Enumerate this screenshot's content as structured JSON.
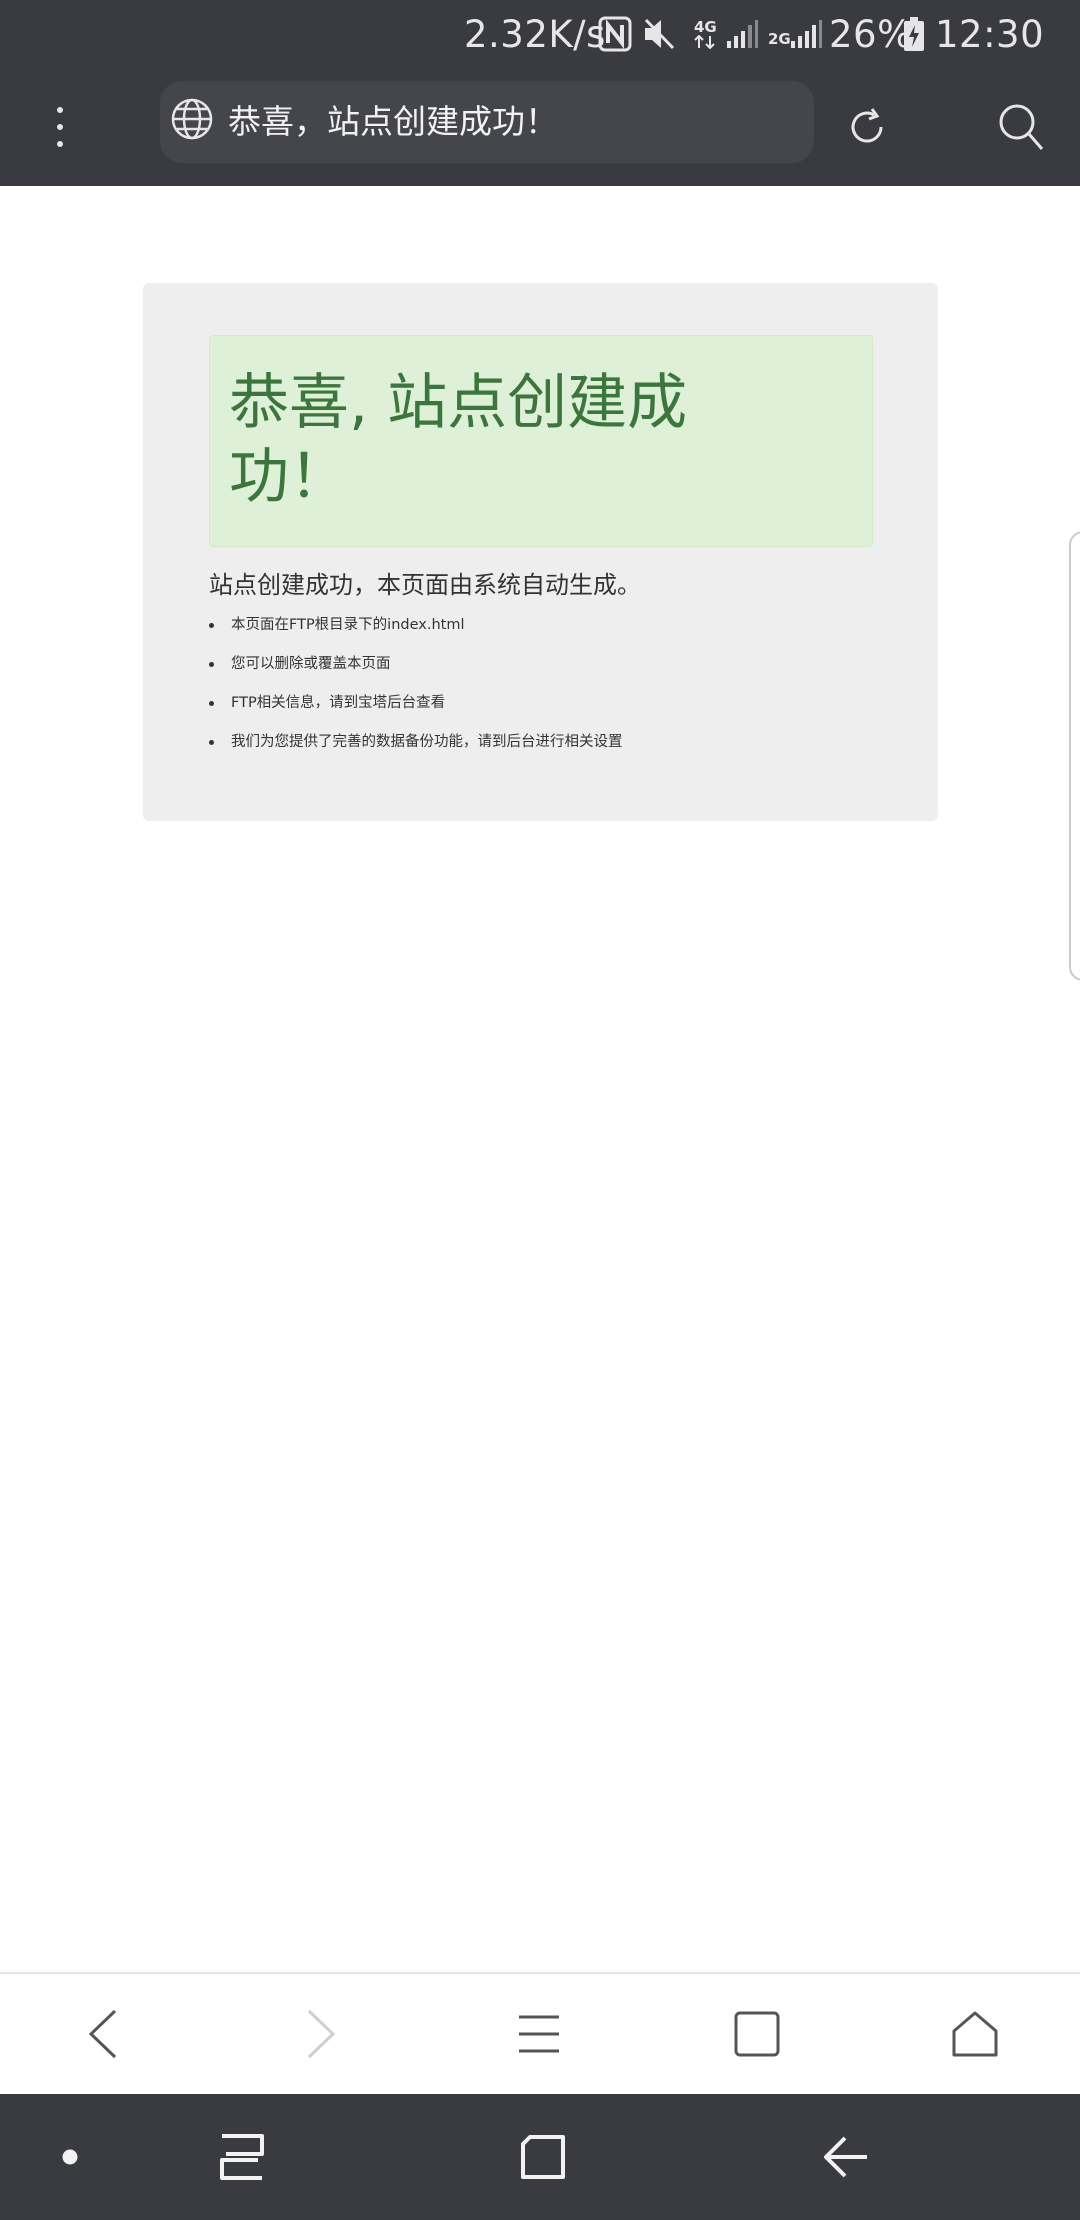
{
  "status_bar": {
    "network_speed": "2.32K/s",
    "net_4g": "4G",
    "net_2g": "2G",
    "battery": "26%",
    "time": "12:30",
    "icons": [
      "nfc-icon",
      "mute-icon",
      "data-arrows-icon",
      "signal-icon",
      "signal-icon",
      "battery-icon"
    ]
  },
  "toolbar": {
    "menu_icon": "more-vertical-icon",
    "url_text": "恭喜，站点创建成功！",
    "globe_icon": "globe-icon",
    "reload_icon": "refresh-icon",
    "search_icon": "search-icon"
  },
  "page": {
    "heading": "恭喜, 站点创建成功！",
    "lead": "站点创建成功，本页面由系统自动生成。",
    "items": [
      "本页面在FTP根目录下的index.html",
      "您可以删除或覆盖本页面",
      "FTP相关信息，请到宝塔后台查看",
      "我们为您提供了完善的数据备份功能，请到后台进行相关设置"
    ],
    "colors": {
      "alert_bg": "#dff0d8",
      "alert_text": "#3c763d",
      "container_bg": "#eeeeee"
    }
  },
  "bottom_bar": {
    "icons": [
      "back-icon",
      "forward-icon",
      "menu-icon",
      "tabs-icon",
      "home-icon"
    ]
  },
  "nav_bar": {
    "icons": [
      "dot-icon",
      "recents-icon",
      "home-square-icon",
      "back-arrow-icon"
    ]
  }
}
